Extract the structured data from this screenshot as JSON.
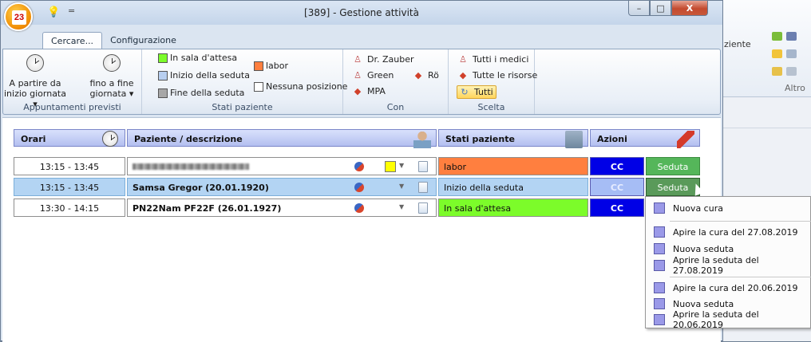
{
  "window": {
    "title": "[389] - Gestione attività",
    "logo_text": "23",
    "controls": {
      "min": "–",
      "max": "□",
      "close": "X"
    }
  },
  "quick_access": {
    "bulb": "💡",
    "more": "="
  },
  "tabs": [
    {
      "label": "Cercare...",
      "active": true
    },
    {
      "label": "Configurazione",
      "active": false
    }
  ],
  "ribbon": {
    "appointments": {
      "caption": "Appuntamenti previsti",
      "start": [
        "A partire da",
        "inizio giornata ▾"
      ],
      "end": [
        "fino a fine",
        "giornata ▾"
      ]
    },
    "patient_states": {
      "caption": "Stati paziente",
      "items": [
        {
          "label": "In sala d'attesa",
          "color": "#7cfc2a"
        },
        {
          "label": "Inizio della seduta",
          "color": "#b8cff0"
        },
        {
          "label": "Fine della seduta",
          "color": "#a7a7a7"
        },
        {
          "label": "labor",
          "color": "#ff7f3f"
        },
        {
          "label": "Nessuna posizione",
          "color": "#ffffff"
        }
      ]
    },
    "with": {
      "caption": "Con",
      "items": [
        "Dr. Zauber",
        "Green",
        "MPA",
        "Rö"
      ]
    },
    "choice": {
      "caption": "Scelta",
      "items": [
        "Tutti i medici",
        "Tutte le risorse",
        "Tutti"
      ]
    }
  },
  "table": {
    "headers": {
      "times": "Orari",
      "patient": "Paziente / descrizione",
      "status": "Stati paziente",
      "actions": "Azioni"
    },
    "rows": [
      {
        "time": "13:15 - 13:45",
        "patient": "",
        "patient_blurred": true,
        "color": "#ffff00",
        "status": "labor",
        "status_color": "#ff7f3f",
        "cc": "CC",
        "action": "Seduta",
        "selected": false
      },
      {
        "time": "13:15 - 13:45",
        "patient": "Samsa Gregor (20.01.1920)",
        "patient_blurred": false,
        "color": "",
        "status": "Inizio della seduta",
        "status_color": "#b3d4f3",
        "cc": "CC",
        "action": "Seduta",
        "selected": true
      },
      {
        "time": "13:30 - 14:15",
        "patient": "PN22Nam PF22F (26.01.1927)",
        "patient_blurred": false,
        "color": "",
        "status": "In sala d'attesa",
        "status_color": "#7cfc2a",
        "cc": "CC",
        "action": "",
        "selected": false
      }
    ]
  },
  "context_menu": {
    "items": [
      "Nuova cura",
      "Apire la cura del 27.08.2019",
      "Nuova seduta",
      "Aprire la seduta del 27.08.2019",
      "Apire la cura del 20.06.2019",
      "Nuova seduta",
      "Aprire la seduta del 20.06.2019"
    ]
  },
  "background_app": {
    "label1": "ziente",
    "label2": "Altro"
  }
}
